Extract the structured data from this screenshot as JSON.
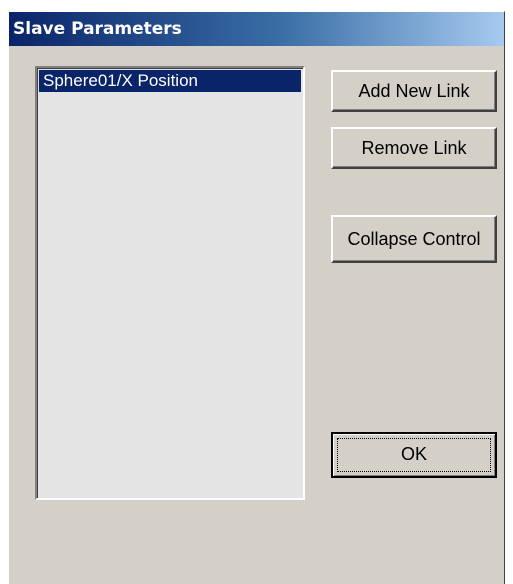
{
  "dialog": {
    "title": "Slave Parameters"
  },
  "list": {
    "items": [
      {
        "label": "Sphere01/X Position",
        "selected": true
      }
    ]
  },
  "buttons": {
    "add_new_link": "Add New Link",
    "remove_link": "Remove Link",
    "collapse_control": "Collapse Control",
    "ok": "OK"
  },
  "colors": {
    "dialog_face": "#d4d0c8",
    "title_gradient_start": "#0a246a",
    "title_gradient_end": "#a6caf0",
    "selection": "#0a246a",
    "list_background": "#e4e4e4"
  }
}
